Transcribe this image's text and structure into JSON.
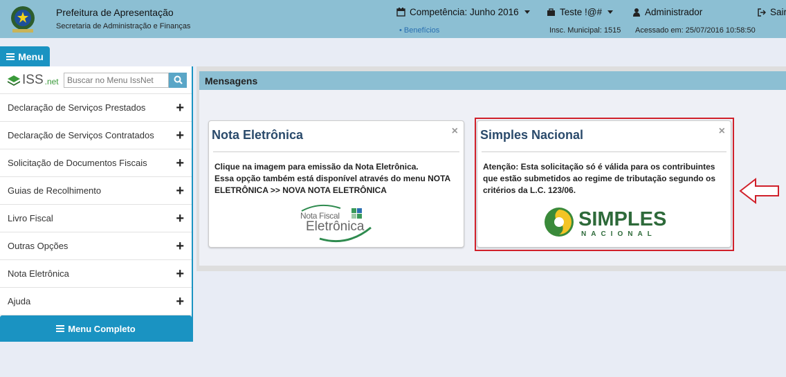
{
  "header": {
    "org_name": "Prefeitura de Apresentação",
    "org_dept": "Secretaria de Administração e Finanças",
    "competencia": "Competência: Junho 2016",
    "beneficios": "• Benefícios",
    "teste": "Teste !@#",
    "inscricao": "Insc. Municipal: 1515",
    "usuario": "Administrador",
    "acesso": "Acessado em: 25/07/2016 10:58:50",
    "sair": "Sair"
  },
  "menu_tab": {
    "label": "Menu"
  },
  "sidebar": {
    "logo_main": "ISS",
    "logo_suffix": ".net",
    "search_placeholder": "Buscar no Menu IssNet",
    "items": [
      {
        "label": "Declaração de Serviços Prestados"
      },
      {
        "label": "Declaração de Serviços Contratados"
      },
      {
        "label": "Solicitação de Documentos Fiscais"
      },
      {
        "label": "Guias de Recolhimento"
      },
      {
        "label": "Livro Fiscal"
      },
      {
        "label": "Outras Opções"
      },
      {
        "label": "Nota Eletrônica"
      },
      {
        "label": "Ajuda"
      }
    ],
    "menu_full": "Menu Completo"
  },
  "messages": {
    "title": "Mensagens",
    "cards": [
      {
        "title": "Nota Eletrônica",
        "text": "Clique na imagem para emissão da Nota Eletrônica.\nEssa opção também está disponível através do menu NOTA ELETRÔNICA >> NOVA NOTA ELETRÔNICA",
        "logo_line1": "Nota Fiscal",
        "logo_line2": "Eletrônica"
      },
      {
        "title": "Simples Nacional",
        "text": "Atenção: Esta solicitação só é válida para os contribuintes que estão submetidos ao regime de tributação segundo os critérios da L.C. 123/06.",
        "logo_line1": "SIMPLES",
        "logo_line2": "NACIONAL"
      }
    ]
  },
  "colors": {
    "header": "#8cbfd3",
    "accent": "#1a93c2",
    "highlight": "#d0202a",
    "card_title": "#2a4a6b"
  }
}
